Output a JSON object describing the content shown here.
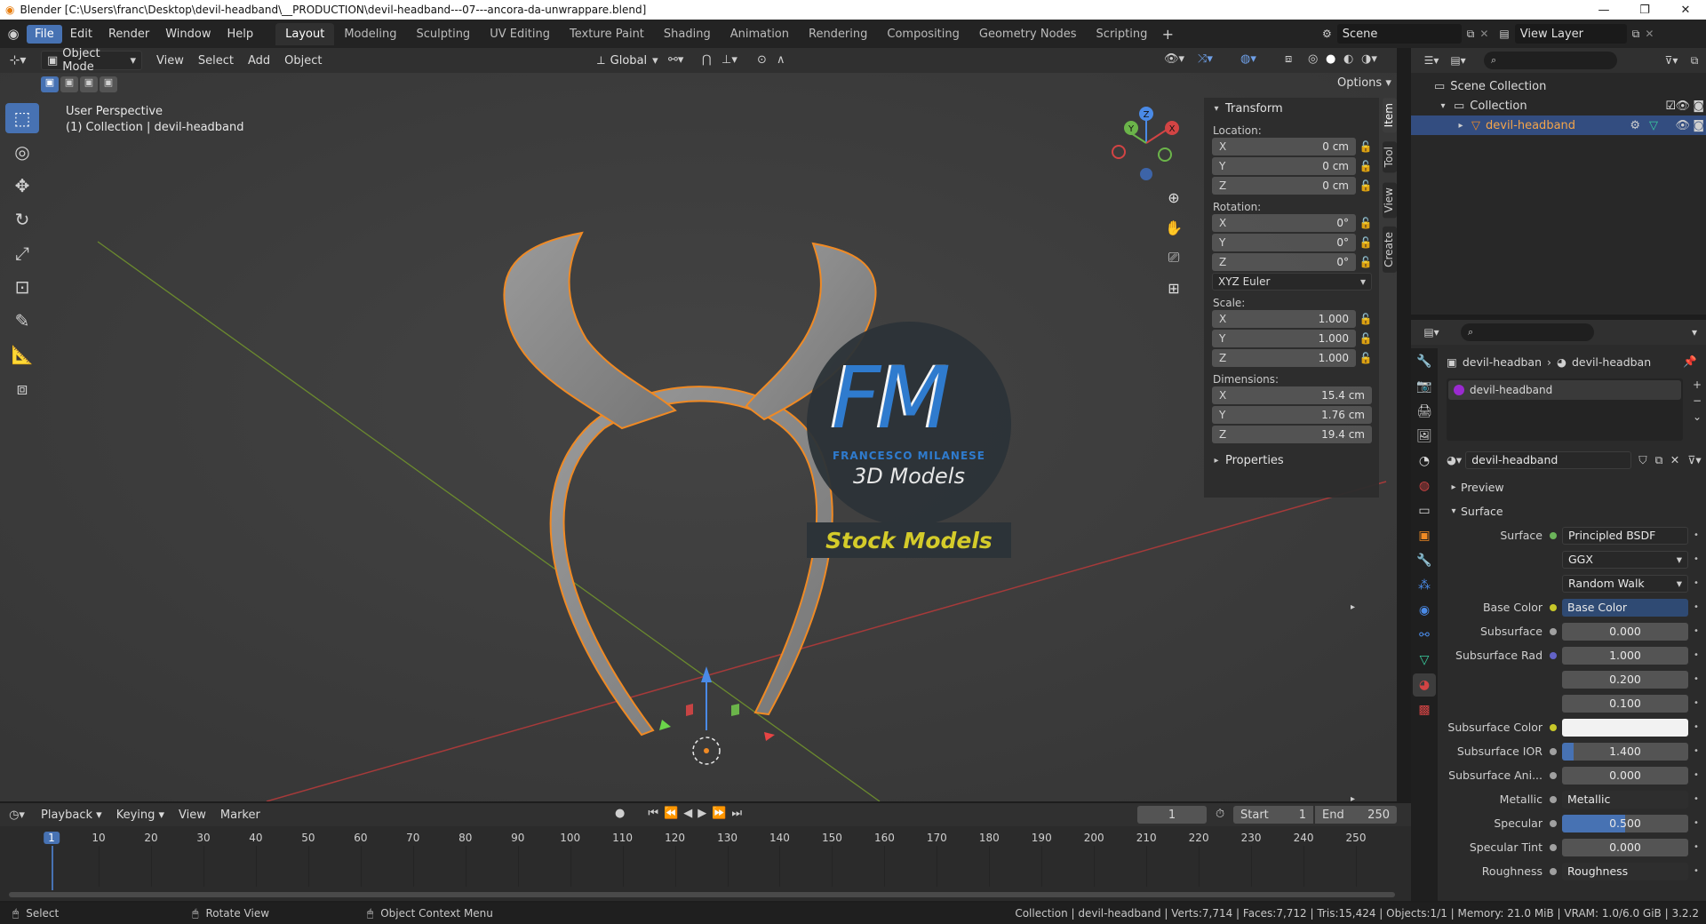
{
  "window": {
    "title": "Blender [C:\\Users\\franc\\Desktop\\devil-headband\\__PRODUCTION\\devil-headband---07---ancora-da-unwrappare.blend]"
  },
  "menu": [
    "File",
    "Edit",
    "Render",
    "Window",
    "Help"
  ],
  "workspaces": [
    "Layout",
    "Modeling",
    "Sculpting",
    "UV Editing",
    "Texture Paint",
    "Shading",
    "Animation",
    "Rendering",
    "Compositing",
    "Geometry Nodes",
    "Scripting"
  ],
  "scene": {
    "name": "Scene",
    "view_layer": "View Layer"
  },
  "viewport_header": {
    "mode": "Object Mode",
    "menus": [
      "View",
      "Select",
      "Add",
      "Object"
    ],
    "orientation": "Global",
    "options": "Options"
  },
  "viewport": {
    "perspective": "User Perspective",
    "collection_info": "(1) Collection | devil-headband",
    "logo": {
      "initials": "FM",
      "name": "FRANCESCO MILANESE",
      "tagline": "3D Models",
      "banner": "Stock Models"
    },
    "gizmo": {
      "x": "X",
      "y": "Y",
      "z": "Z"
    }
  },
  "n_panel": {
    "tabs": [
      "Item",
      "Tool",
      "View",
      "Create"
    ],
    "transform_title": "Transform",
    "location_label": "Location:",
    "location": [
      {
        "axis": "X",
        "value": "0 cm"
      },
      {
        "axis": "Y",
        "value": "0 cm"
      },
      {
        "axis": "Z",
        "value": "0 cm"
      }
    ],
    "rotation_label": "Rotation:",
    "rotation": [
      {
        "axis": "X",
        "value": "0°"
      },
      {
        "axis": "Y",
        "value": "0°"
      },
      {
        "axis": "Z",
        "value": "0°"
      }
    ],
    "rotation_mode": "XYZ Euler",
    "scale_label": "Scale:",
    "scale": [
      {
        "axis": "X",
        "value": "1.000"
      },
      {
        "axis": "Y",
        "value": "1.000"
      },
      {
        "axis": "Z",
        "value": "1.000"
      }
    ],
    "dimensions_label": "Dimensions:",
    "dimensions": [
      {
        "axis": "X",
        "value": "15.4 cm"
      },
      {
        "axis": "Y",
        "value": "1.76 cm"
      },
      {
        "axis": "Z",
        "value": "19.4 cm"
      }
    ],
    "properties_title": "Properties"
  },
  "outliner": {
    "scene_collection": "Scene Collection",
    "collection": "Collection",
    "object": "devil-headband"
  },
  "properties": {
    "breadcrumb_object": "devil-headban",
    "breadcrumb_material": "devil-headban",
    "slot_name": "devil-headband",
    "material_name": "devil-headband",
    "preview_label": "Preview",
    "surface_label": "Surface",
    "rows": [
      {
        "label": "Surface",
        "value": "Principled BSDF",
        "dot": "#6bb45a",
        "kind": "dark"
      },
      {
        "label": "",
        "value": "GGX",
        "kind": "select"
      },
      {
        "label": "",
        "value": "Random Walk",
        "kind": "select"
      },
      {
        "label": "Base Color",
        "value": "Base Color",
        "dot": "#c7c729",
        "kind": "link",
        "expand": true
      },
      {
        "label": "Subsurface",
        "value": "0.000",
        "dot": "#a0a0a0",
        "kind": "num"
      },
      {
        "label": "Subsurface Rad",
        "value": "1.000",
        "dot": "#6363c7",
        "kind": "num"
      },
      {
        "label": "",
        "value": "0.200",
        "kind": "num"
      },
      {
        "label": "",
        "value": "0.100",
        "kind": "num"
      },
      {
        "label": "Subsurface Color",
        "value": "",
        "dot": "#c7c729",
        "kind": "color"
      },
      {
        "label": "Subsurface IOR",
        "value": "1.400",
        "dot": "#a0a0a0",
        "kind": "slider"
      },
      {
        "label": "Subsurface Ani...",
        "value": "0.000",
        "dot": "#a0a0a0",
        "kind": "num"
      },
      {
        "label": "Metallic",
        "value": "Metallic",
        "dot": "#a0a0a0",
        "kind": "link",
        "expand": true
      },
      {
        "label": "Specular",
        "value": "0.500",
        "dot": "#a0a0a0",
        "kind": "specular"
      },
      {
        "label": "Specular Tint",
        "value": "0.000",
        "dot": "#a0a0a0",
        "kind": "num"
      },
      {
        "label": "Roughness",
        "value": "Roughness",
        "dot": "#a0a0a0",
        "kind": "link",
        "expand": true
      }
    ]
  },
  "timeline": {
    "menus": [
      "Playback",
      "Keying",
      "View",
      "Marker"
    ],
    "current_frame": "1",
    "start_label": "Start",
    "start": "1",
    "end_label": "End",
    "end": "250",
    "ticks": [
      "1",
      "10",
      "20",
      "30",
      "40",
      "50",
      "60",
      "70",
      "80",
      "90",
      "100",
      "110",
      "120",
      "130",
      "140",
      "150",
      "160",
      "170",
      "180",
      "190",
      "200",
      "210",
      "220",
      "230",
      "240",
      "250"
    ]
  },
  "status": {
    "select": "Select",
    "rotate": "Rotate View",
    "context": "Object Context Menu",
    "info": "Collection | devil-headband | Verts:7,714 | Faces:7,712 | Tris:15,424 | Objects:1/1 | Memory: 21.0 MiB | VRAM: 1.0/6.0 GiB | 3.2.2"
  }
}
